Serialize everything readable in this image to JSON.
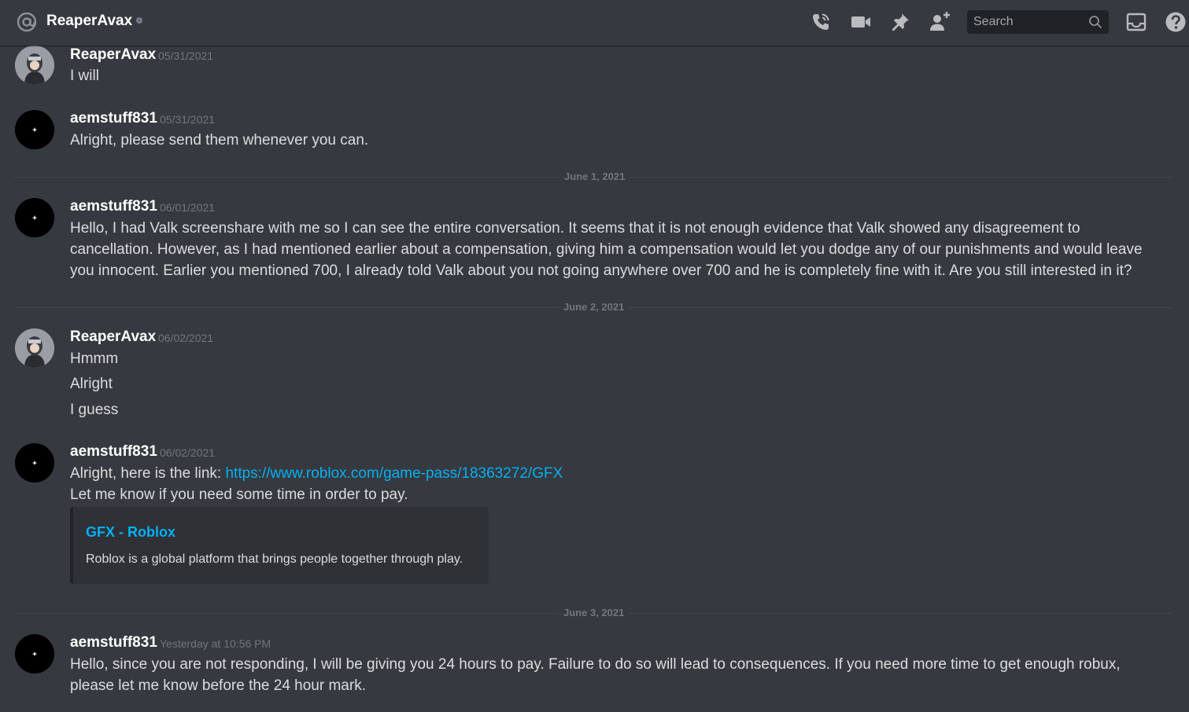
{
  "header": {
    "title": "ReaperAvax",
    "search_placeholder": "Search",
    "icons": [
      "at-icon",
      "phone-call-icon",
      "video-call-icon",
      "pin-icon",
      "add-friend-icon",
      "search-icon",
      "inbox-icon",
      "help-icon"
    ]
  },
  "colors": {
    "background": "#36393f",
    "link": "#00b0f4",
    "username": "#ffffff",
    "timestamp": "#72767d"
  },
  "messages": [
    {
      "author": "ReaperAvax",
      "timestamp": "05/31/2021",
      "lines": [
        "I will"
      ]
    },
    {
      "author": "aemstuff831",
      "timestamp": "05/31/2021",
      "lines": [
        "Alright, please send them whenever you can."
      ]
    },
    {
      "author": "aemstuff831",
      "timestamp": "06/01/2021",
      "lines": [
        "Hello, I had Valk screenshare with me so I can see the entire conversation. It seems that it is not enough evidence that Valk showed any disagreement to",
        "cancellation. However, as I had mentioned earlier about a compensation, giving him a compensation would let you dodge any of our punishments and would leave",
        "you innocent. Earlier you mentioned 700, I already told Valk about you not going anywhere over 700 and he is completely fine with it. Are you still interested in it?"
      ]
    },
    {
      "author": "ReaperAvax",
      "timestamp": "06/02/2021",
      "lines": [
        "Hmmm",
        "Alright",
        "I guess"
      ]
    },
    {
      "author": "aemstuff831",
      "timestamp": "06/02/2021",
      "line1_prefix": "Alright, here is the link: ",
      "line1_link": "https://www.roblox.com/game-pass/18363272/GFX",
      "line2": "Let me know if you need some time in order to pay.",
      "embed": {
        "title": "GFX - Roblox",
        "description": "Roblox is a global platform that brings people together through play."
      }
    },
    {
      "author": "aemstuff831",
      "timestamp": "Yesterday at 10:56 PM",
      "lines": [
        "Hello, since you are not responding, I will be giving you 24 hours to pay. Failure to do so will lead to consequences. If you need more time to get enough robux,",
        "please let me know before the 24 hour mark."
      ]
    }
  ],
  "dividers": [
    "June 1, 2021",
    "June 2, 2021",
    "June 3, 2021"
  ]
}
